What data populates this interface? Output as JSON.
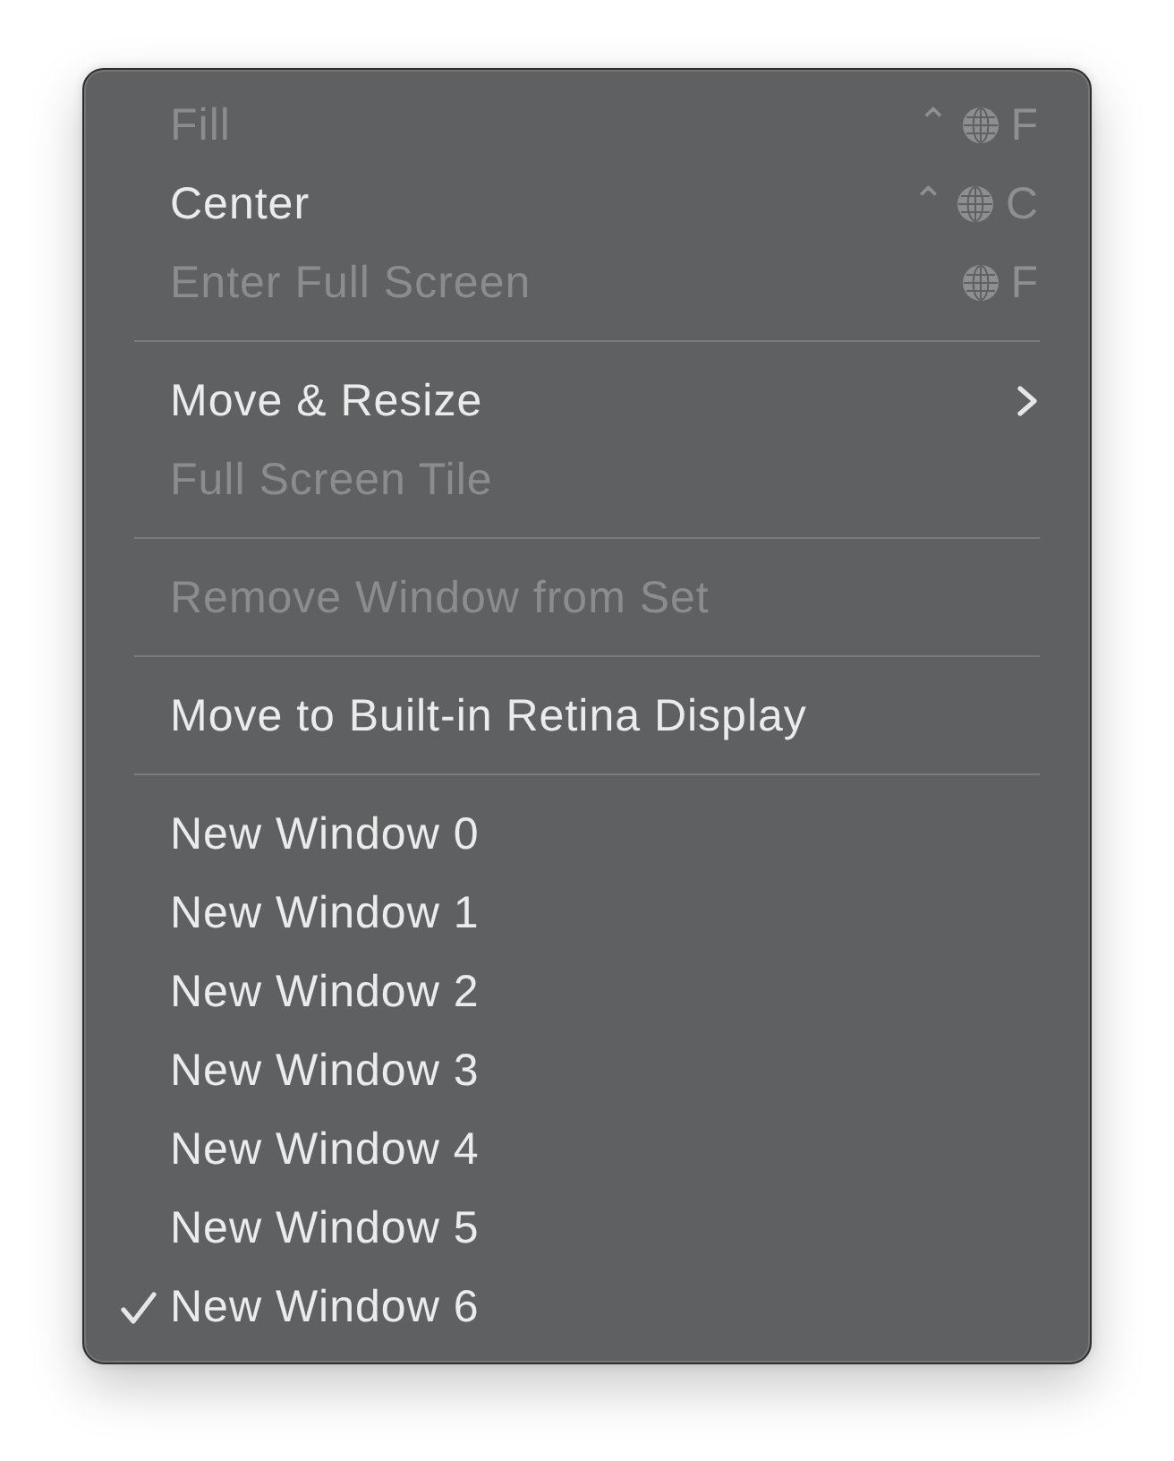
{
  "menu": {
    "sections": [
      {
        "items": [
          {
            "kind": "command",
            "label": "Fill",
            "disabled": true,
            "shortcut": [
              {
                "kind": "symbol",
                "text": "⌃"
              },
              {
                "kind": "globe"
              },
              {
                "kind": "key",
                "text": "F"
              }
            ]
          },
          {
            "kind": "command",
            "label": "Center",
            "disabled": false,
            "shortcut": [
              {
                "kind": "symbol",
                "text": "⌃"
              },
              {
                "kind": "globe"
              },
              {
                "kind": "key",
                "text": "C"
              }
            ]
          },
          {
            "kind": "command",
            "label": "Enter Full Screen",
            "disabled": true,
            "shortcut": [
              {
                "kind": "globe"
              },
              {
                "kind": "key",
                "text": "F"
              }
            ]
          }
        ]
      },
      {
        "items": [
          {
            "kind": "submenu",
            "label": "Move & Resize",
            "disabled": false
          },
          {
            "kind": "command",
            "label": "Full Screen Tile",
            "disabled": true
          }
        ]
      },
      {
        "items": [
          {
            "kind": "command",
            "label": "Remove Window from Set",
            "disabled": true
          }
        ]
      },
      {
        "items": [
          {
            "kind": "command",
            "label": "Move to Built-in Retina Display",
            "disabled": false
          }
        ]
      },
      {
        "items": [
          {
            "kind": "command",
            "label": "New Window 0",
            "disabled": false,
            "checked": false
          },
          {
            "kind": "command",
            "label": "New Window 1",
            "disabled": false,
            "checked": false
          },
          {
            "kind": "command",
            "label": "New Window 2",
            "disabled": false,
            "checked": false
          },
          {
            "kind": "command",
            "label": "New Window 3",
            "disabled": false,
            "checked": false
          },
          {
            "kind": "command",
            "label": "New Window 4",
            "disabled": false,
            "checked": false
          },
          {
            "kind": "command",
            "label": "New Window 5",
            "disabled": false,
            "checked": false
          },
          {
            "kind": "command",
            "label": "New Window 6",
            "disabled": false,
            "checked": true
          }
        ]
      }
    ]
  }
}
